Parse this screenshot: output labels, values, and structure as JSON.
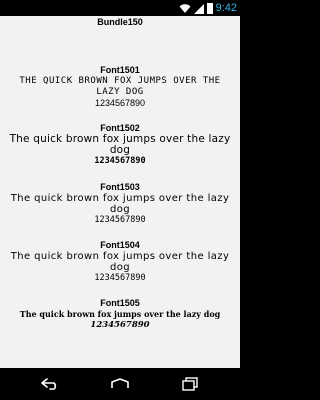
{
  "status_bar": {
    "time": "9:42",
    "icons": [
      "wifi-icon",
      "signal-icon",
      "battery-icon"
    ]
  },
  "app": {
    "title": "Bundle150"
  },
  "fonts": [
    {
      "name": "Font1501",
      "sample": "the quick brown fox jumps over the lazy dog",
      "digits": "1234567890"
    },
    {
      "name": "Font1502",
      "sample": "The quick brown fox jumps over the lazy dog",
      "digits": "1234567890"
    },
    {
      "name": "Font1503",
      "sample": "The quick brown fox jumps over the lazy dog",
      "digits": "1234567890"
    },
    {
      "name": "Font1504",
      "sample": "The quick brown fox jumps over the lazy dog",
      "digits": "1234567890"
    },
    {
      "name": "Font1505",
      "sample": "The quick brown fox jumps over the lazy dog",
      "digits": "1234567890"
    }
  ],
  "nav_bar": {
    "icons": [
      "back-icon",
      "home-icon",
      "recents-icon"
    ]
  },
  "colors": {
    "status_time": "#33b5e5",
    "content_bg": "#f2f2f2",
    "bars_bg": "#000000"
  }
}
